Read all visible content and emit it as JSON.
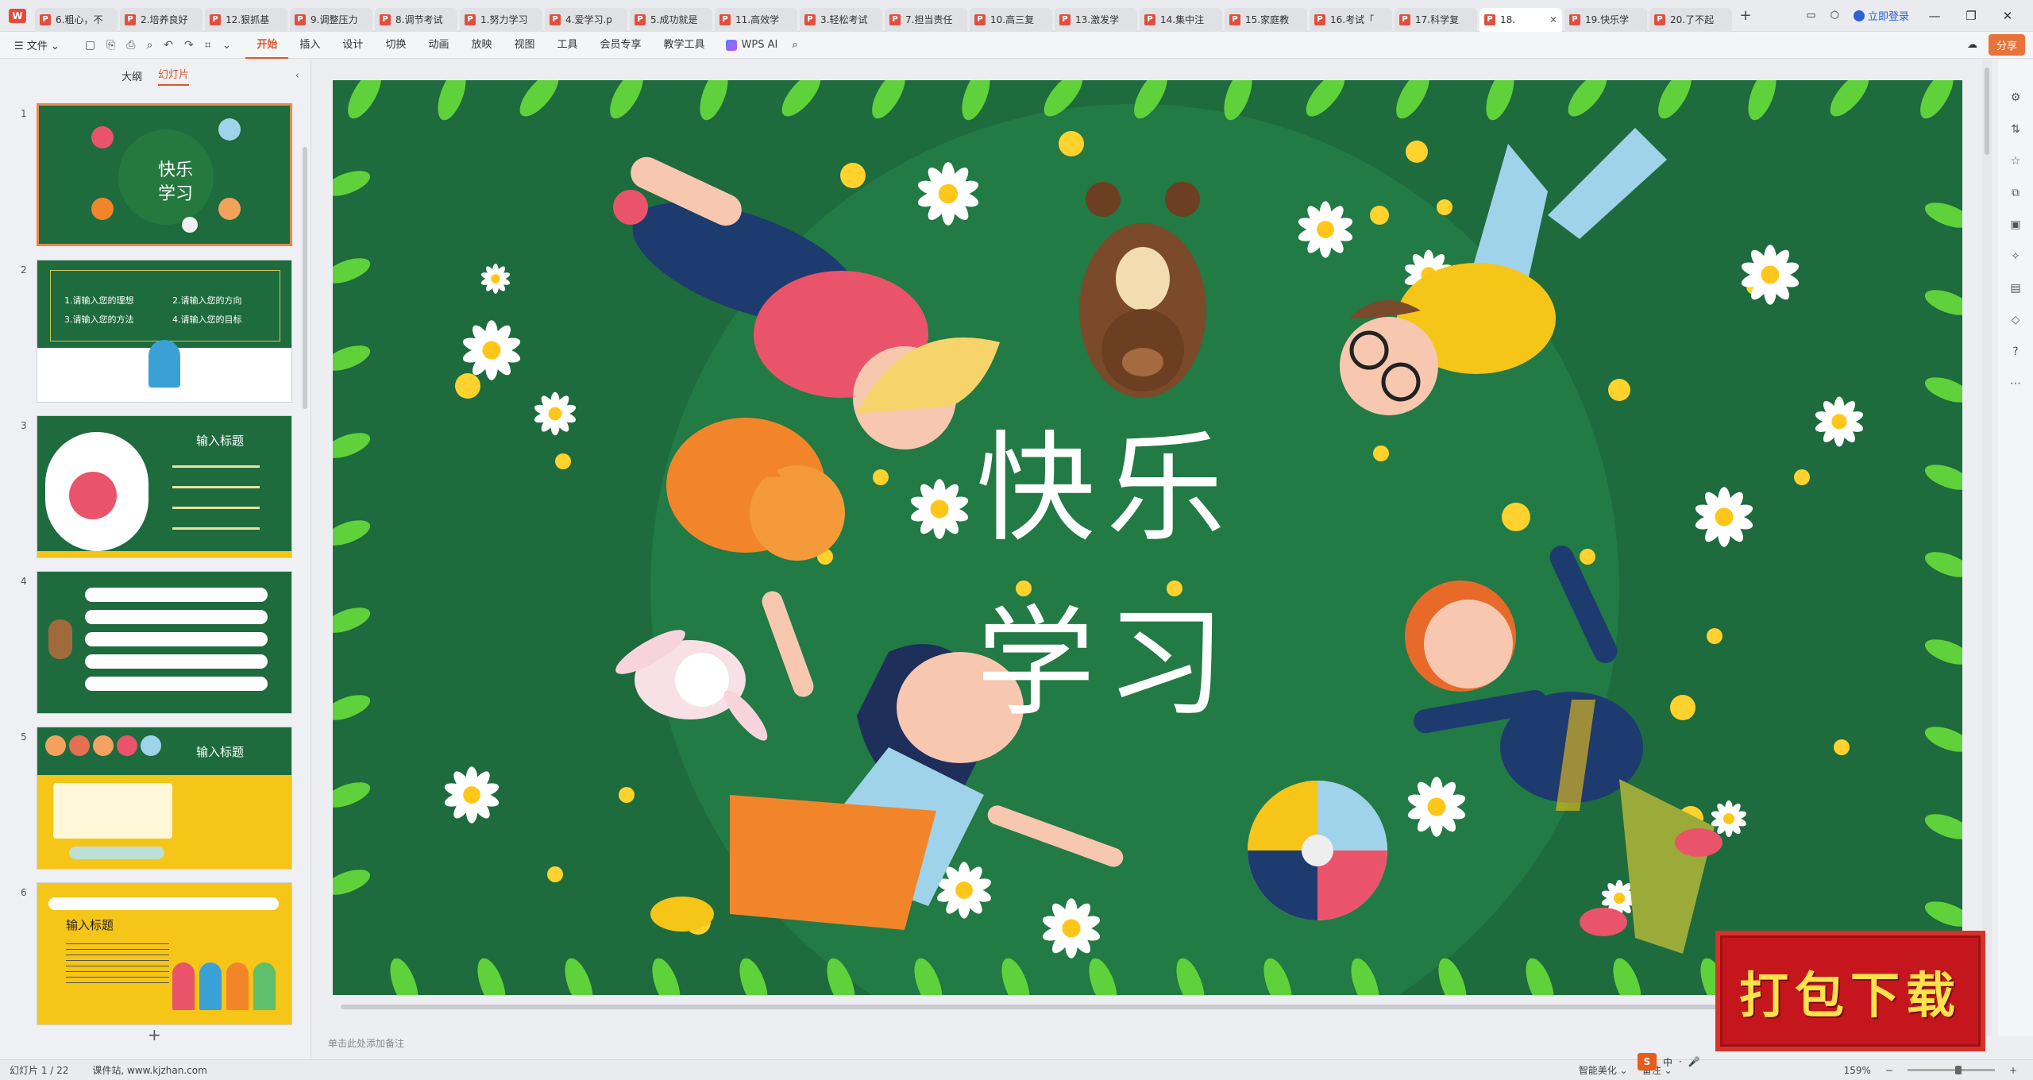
{
  "app": {
    "logo": "W"
  },
  "tabs": [
    {
      "label": "6.粗心，不"
    },
    {
      "label": "2.培养良好"
    },
    {
      "label": "12.狠抓基"
    },
    {
      "label": "9.调整压力"
    },
    {
      "label": "8.调节考试"
    },
    {
      "label": "1.努力学习"
    },
    {
      "label": "4.爱学习.p"
    },
    {
      "label": "5.成功就是"
    },
    {
      "label": "11.高效学"
    },
    {
      "label": "3.轻松考试"
    },
    {
      "label": "7.担当责任"
    },
    {
      "label": "10.高三复"
    },
    {
      "label": "13.激发学"
    },
    {
      "label": "14.集中注"
    },
    {
      "label": "15.家庭教"
    },
    {
      "label": "16.考试「"
    },
    {
      "label": "17.科学复"
    },
    {
      "label": "18.",
      "active": true
    },
    {
      "label": "19.快乐学"
    },
    {
      "label": "20.了不起"
    }
  ],
  "tab_icon_letter": "P",
  "tab_close": "✕",
  "tab_new": "+",
  "login": "立即登录",
  "ribbon": {
    "file_menu": "☰ 文件 ⌄",
    "tabs": [
      "开始",
      "插入",
      "设计",
      "切换",
      "动画",
      "放映",
      "视图",
      "工具",
      "会员专享",
      "教学工具"
    ],
    "active_tab": "开始",
    "wps_ai": "WPS AI",
    "share": "分享"
  },
  "left_panel": {
    "tab_outline": "大纲",
    "tab_slides": "幻灯片",
    "slide_numbers": [
      "1",
      "2",
      "3",
      "4",
      "5",
      "6"
    ],
    "add_slide": "+",
    "thumb2": {
      "items": [
        "1.请输入您的理想",
        "2.请输入您的方向",
        "3.请输入您的方法",
        "4.请输入您的目标"
      ]
    },
    "thumb3": {
      "title": "输入标题"
    },
    "thumb5": {
      "title": "输入标题"
    },
    "thumb6": {
      "title": "输入标题"
    }
  },
  "slide": {
    "title_line1": "快乐",
    "title_line2": "学习"
  },
  "notes_placeholder": "单击此处添加备注",
  "statusbar": {
    "slide_info": "幻灯片 1 / 22",
    "site": "课件站, www.kjzhan.com",
    "smart_beautify": "智能美化 ⌄",
    "notes": "备注 ⌄",
    "zoom": "159%"
  },
  "download_badge": "打包下载",
  "colors": {
    "accent": "#d9592c",
    "slide_bg": "#1e6b3e",
    "leaf": "#5fd13a",
    "dot": "#ffd22e"
  }
}
